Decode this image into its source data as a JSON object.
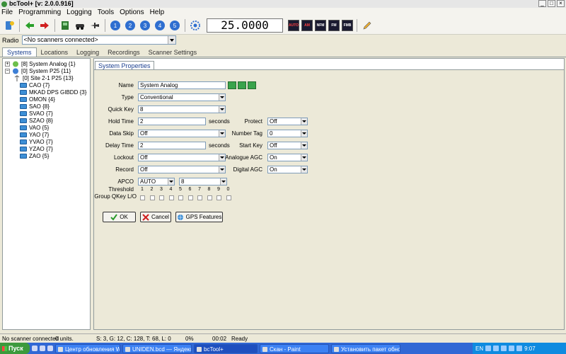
{
  "window": {
    "title": "bcTool+ [v: 2.0.0.916]"
  },
  "menu": [
    "File",
    "Programming",
    "Logging",
    "Tools",
    "Options",
    "Help"
  ],
  "toolbar": {
    "frequency": "25.0000",
    "numbered_buttons": [
      "1",
      "2",
      "3",
      "4",
      "5"
    ],
    "mode_buttons": [
      "AUTO",
      "AM",
      "NFM",
      "FM",
      "FMB"
    ]
  },
  "radio": {
    "label": "Radio",
    "selected": "<No scanners connected>"
  },
  "main_tabs": [
    "Systems",
    "Locations",
    "Logging",
    "Recordings",
    "Scanner Settings"
  ],
  "tree": {
    "systems": [
      {
        "label": "[8] System Analog {1}"
      },
      {
        "label": "[0] System P25 {11}"
      }
    ],
    "site": "[0] Site  2-1   P25 {13}",
    "groups": [
      "CAO {7}",
      "MKAD DPS GIBDD {3}",
      "OMON {4}",
      "SAO {8}",
      "SVAO {7}",
      "SZAO {8}",
      "VAO {5}",
      "YAO {7}",
      "YVAO {7}",
      "YZAO {7}",
      "ZAO {5}"
    ]
  },
  "panel": {
    "tab": "System Properties",
    "fields": {
      "name": {
        "label": "Name",
        "value": "System Analog"
      },
      "type": {
        "label": "Type",
        "value": "Conventional"
      },
      "quick_key": {
        "label": "Quick Key",
        "value": "8"
      },
      "hold_time": {
        "label": "Hold Time",
        "value": "2",
        "unit": "seconds"
      },
      "data_skip": {
        "label": "Data Skip",
        "value": "Off"
      },
      "delay_time": {
        "label": "Delay Time",
        "value": "2",
        "unit": "seconds"
      },
      "lockout": {
        "label": "Lockout",
        "value": "Off"
      },
      "record": {
        "label": "Record",
        "value": "Off"
      },
      "apco_threshold": {
        "label": "APCO Threshold",
        "value": "AUTO",
        "value2": "8"
      },
      "protect": {
        "label": "Protect",
        "value": "Off"
      },
      "number_tag": {
        "label": "Number Tag",
        "value": "0"
      },
      "start_key": {
        "label": "Start Key",
        "value": "Off"
      },
      "analogue_agc": {
        "label": "Analogue AGC",
        "value": "On"
      },
      "digital_agc": {
        "label": "Digital AGC",
        "value": "On"
      }
    },
    "group_qkey": {
      "label": "Group QKey L/O",
      "digits": [
        "1",
        "2",
        "3",
        "4",
        "5",
        "6",
        "7",
        "8",
        "9",
        "0"
      ]
    },
    "buttons": {
      "ok": "OK",
      "cancel": "Cancel",
      "gps": "GPS Features"
    }
  },
  "statusbar": {
    "connection": "No scanner connected",
    "units": "0 units.",
    "info": "S: 3, G: 12, C: 128, T: 68, L: 0",
    "percent": "0%",
    "time": "00:02",
    "state": "Ready"
  },
  "taskbar": {
    "start": "Пуск",
    "tasks": [
      {
        "label": "Центр обновления Win..."
      },
      {
        "label": "UNIDEN.bcd — Яндекс...."
      },
      {
        "label": "bcTool+"
      },
      {
        "label": "Скан - Paint"
      },
      {
        "label": "Установить пакет обно..."
      }
    ],
    "lang": "EN",
    "clock": "9:07"
  },
  "colors": {
    "accent_green": "#3aa34c",
    "folder_blue": "#3d8fd6",
    "taskbar_blue": "#3168d5"
  }
}
